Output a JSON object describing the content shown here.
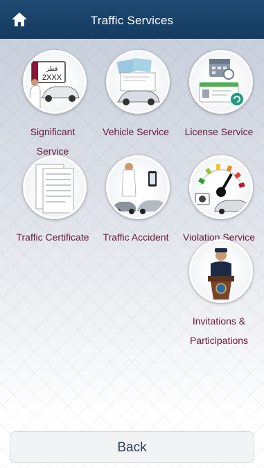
{
  "header": {
    "title": "Traffic Services",
    "home_icon": "home-icon"
  },
  "tiles": [
    {
      "label_line1": "Significant",
      "label_line2": "Service",
      "icon": "license-plate-icon",
      "plate_arabic": "قطر",
      "plate_text": "2XXX"
    },
    {
      "label_line1": "Vehicle Service",
      "icon": "vehicle-registration-icon"
    },
    {
      "label_line1": "License Service",
      "icon": "license-calendar-icon"
    },
    {
      "label_line1": "Traffic Certificate",
      "icon": "certificate-document-icon"
    },
    {
      "label_line1": "Traffic Accident",
      "icon": "accident-icon"
    },
    {
      "label_line1": "Violation Service",
      "icon": "speed-camera-icon"
    },
    {
      "label_line1": "Invitations &",
      "label_line2": "Participations",
      "icon": "officer-podium-icon"
    }
  ],
  "footer": {
    "back_label": "Back"
  },
  "colors": {
    "header": "#1a4268",
    "tile_label": "#6a1738",
    "back_text": "#2c3e50"
  }
}
